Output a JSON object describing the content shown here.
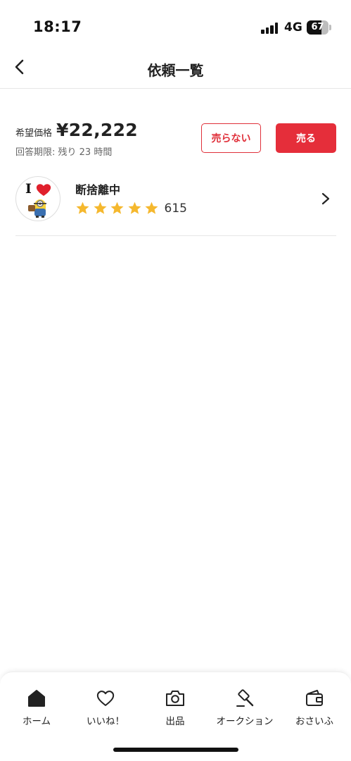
{
  "status_bar": {
    "time": "18:17",
    "network": "4G",
    "battery": "67",
    "battery_level": 0.67
  },
  "nav": {
    "back_icon": "chevron-left-icon",
    "title": "依頼一覧"
  },
  "offer": {
    "price_label": "希望価格",
    "price": "¥22,222",
    "deadline": "回答期限: 残り 23 時間",
    "decline_label": "売らない",
    "sell_label": "売る",
    "accent_color": "#e52e3a"
  },
  "seller": {
    "name": "断捨離中",
    "rating_stars": 5,
    "rating_count": "615",
    "star_color": "#f5b82e",
    "avatar_text": "I",
    "avatar_icon": "heart-icon"
  },
  "tabbar": {
    "tabs": [
      {
        "label": "ホーム",
        "icon": "home-icon"
      },
      {
        "label": "いいね！",
        "icon": "heart-outline-icon"
      },
      {
        "label": "出品",
        "icon": "camera-icon"
      },
      {
        "label": "オークション",
        "icon": "gavel-icon"
      },
      {
        "label": "おさいふ",
        "icon": "wallet-icon"
      }
    ]
  }
}
